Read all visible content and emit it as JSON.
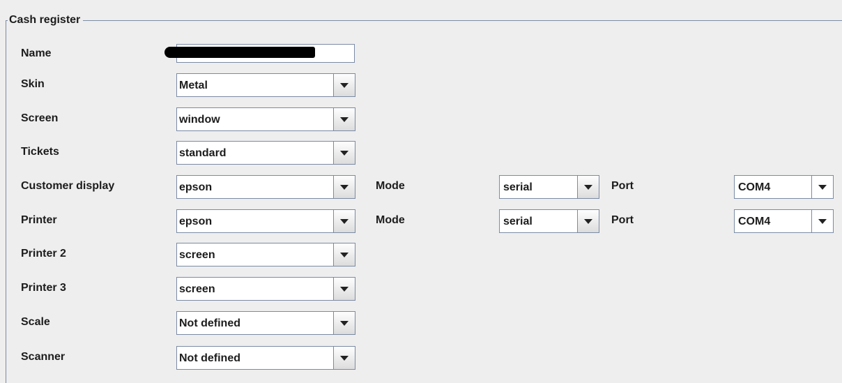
{
  "panel": {
    "title": "Cash register"
  },
  "name": {
    "label": "Name"
  },
  "rows": {
    "skin": {
      "label": "Skin",
      "value": "Metal"
    },
    "screen": {
      "label": "Screen",
      "value": "window"
    },
    "tickets": {
      "label": "Tickets",
      "value": "standard"
    },
    "customer_display": {
      "label": "Customer display",
      "value": "epson",
      "mode_label": "Mode",
      "mode_value": "serial",
      "port_label": "Port",
      "port_value": "COM4"
    },
    "printer": {
      "label": "Printer",
      "value": "epson",
      "mode_label": "Mode",
      "mode_value": "serial",
      "port_label": "Port",
      "port_value": "COM4"
    },
    "printer2": {
      "label": "Printer 2",
      "value": "screen"
    },
    "printer3": {
      "label": "Printer 3",
      "value": "screen"
    },
    "scale": {
      "label": "Scale",
      "value": "Not defined"
    },
    "scanner": {
      "label": "Scanner",
      "value": "Not defined"
    }
  },
  "icons": {
    "dropdown": "chevron-down-icon"
  },
  "colors": {
    "background": "#eeeeee",
    "border": "#7a8aa4",
    "field": "#ffffff"
  }
}
